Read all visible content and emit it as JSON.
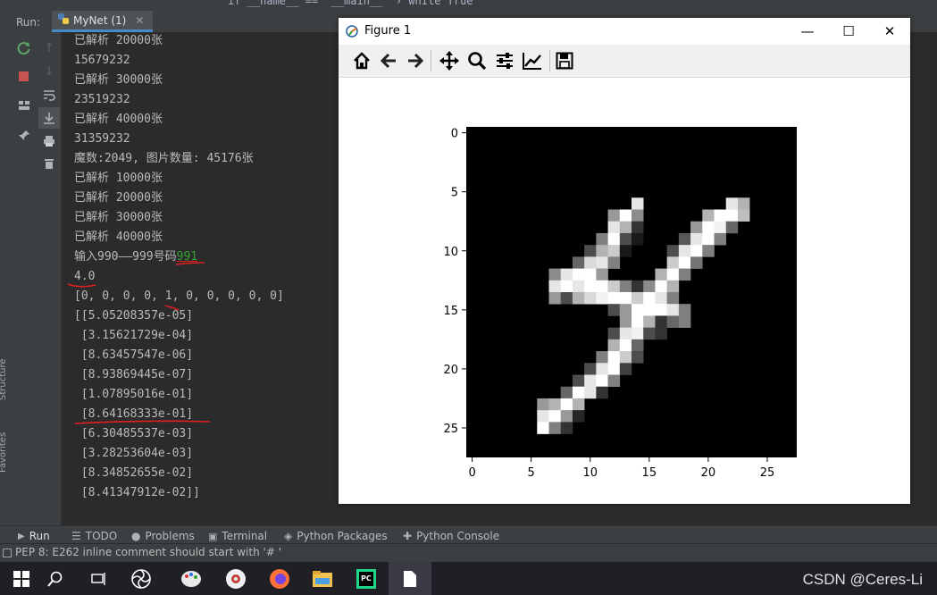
{
  "ide": {
    "breadcrumb": "if __name__ == '__main__'   ›  while True",
    "run_label": "Run:",
    "run_tab": "MyNet (1)",
    "side_labels": [
      "Structure",
      "Favorites"
    ]
  },
  "console": {
    "lines": [
      "已解析 20000张",
      "15679232",
      "已解析 30000张",
      "23519232",
      "已解析 40000张",
      "31359232",
      "魔数:2049, 图片数量: 45176张",
      "已解析 10000张",
      "已解析 20000张",
      "已解析 30000张",
      "已解析 40000张",
      "输入990——999号码",
      "4.0",
      "[0, 0, 0, 0, 1, 0, 0, 0, 0, 0]",
      "[[5.05208357e-05]",
      " [3.15621729e-04]",
      " [8.63457547e-06]",
      " [8.93869445e-07]",
      " [1.07895016e-01]",
      " [8.64168333e-01]",
      " [6.30485537e-03]",
      " [3.28253604e-03]",
      " [8.34852655e-02]",
      " [8.41347912e-02]]"
    ],
    "user_input": "991",
    "user_input_color": "#2fa32f",
    "annotation_color": "#e02020"
  },
  "figure": {
    "window_title": "Figure 1",
    "toolbar_icons": [
      "home-icon",
      "back-icon",
      "forward-icon",
      "pan-icon",
      "zoom-icon",
      "configure-subplots-icon",
      "edit-axis-icon",
      "save-icon"
    ]
  },
  "chart_data": {
    "type": "heatmap",
    "title": "",
    "colormap": "gray",
    "image_size": [
      28,
      28
    ],
    "xticks": [
      0,
      5,
      10,
      15,
      20,
      25
    ],
    "yticks": [
      0,
      5,
      10,
      15,
      20,
      25
    ],
    "pixels": [
      {
        "r": 6,
        "c": 14,
        "v": 0.9
      },
      {
        "r": 6,
        "c": 22,
        "v": 0.9
      },
      {
        "r": 6,
        "c": 23,
        "v": 0.7
      },
      {
        "r": 7,
        "c": 12,
        "v": 0.6
      },
      {
        "r": 7,
        "c": 13,
        "v": 1.0
      },
      {
        "r": 7,
        "c": 14,
        "v": 0.55
      },
      {
        "r": 7,
        "c": 20,
        "v": 0.7
      },
      {
        "r": 7,
        "c": 21,
        "v": 1.0
      },
      {
        "r": 7,
        "c": 22,
        "v": 1.0
      },
      {
        "r": 7,
        "c": 23,
        "v": 0.75
      },
      {
        "r": 8,
        "c": 12,
        "v": 0.9
      },
      {
        "r": 8,
        "c": 13,
        "v": 0.7
      },
      {
        "r": 8,
        "c": 14,
        "v": 0.2
      },
      {
        "r": 8,
        "c": 19,
        "v": 0.6
      },
      {
        "r": 8,
        "c": 20,
        "v": 1.0
      },
      {
        "r": 8,
        "c": 21,
        "v": 0.95
      },
      {
        "r": 8,
        "c": 22,
        "v": 0.4
      },
      {
        "r": 9,
        "c": 11,
        "v": 0.5
      },
      {
        "r": 9,
        "c": 12,
        "v": 1.0
      },
      {
        "r": 9,
        "c": 13,
        "v": 0.3
      },
      {
        "r": 9,
        "c": 14,
        "v": 0.1
      },
      {
        "r": 9,
        "c": 18,
        "v": 0.35
      },
      {
        "r": 9,
        "c": 19,
        "v": 0.9
      },
      {
        "r": 9,
        "c": 20,
        "v": 1.0
      },
      {
        "r": 9,
        "c": 21,
        "v": 0.5
      },
      {
        "r": 10,
        "c": 10,
        "v": 0.3
      },
      {
        "r": 10,
        "c": 11,
        "v": 0.7
      },
      {
        "r": 10,
        "c": 12,
        "v": 0.8
      },
      {
        "r": 10,
        "c": 13,
        "v": 0.1
      },
      {
        "r": 10,
        "c": 17,
        "v": 0.3
      },
      {
        "r": 10,
        "c": 18,
        "v": 0.9
      },
      {
        "r": 10,
        "c": 19,
        "v": 1.0
      },
      {
        "r": 10,
        "c": 20,
        "v": 0.5
      },
      {
        "r": 11,
        "c": 9,
        "v": 0.4
      },
      {
        "r": 11,
        "c": 10,
        "v": 0.85
      },
      {
        "r": 11,
        "c": 11,
        "v": 0.9
      },
      {
        "r": 11,
        "c": 12,
        "v": 0.5
      },
      {
        "r": 11,
        "c": 17,
        "v": 0.8
      },
      {
        "r": 11,
        "c": 18,
        "v": 1.0
      },
      {
        "r": 11,
        "c": 19,
        "v": 0.45
      },
      {
        "r": 12,
        "c": 7,
        "v": 0.55
      },
      {
        "r": 12,
        "c": 8,
        "v": 0.9
      },
      {
        "r": 12,
        "c": 9,
        "v": 1.0
      },
      {
        "r": 12,
        "c": 10,
        "v": 1.0
      },
      {
        "r": 12,
        "c": 11,
        "v": 0.6
      },
      {
        "r": 12,
        "c": 16,
        "v": 0.7
      },
      {
        "r": 12,
        "c": 17,
        "v": 1.0
      },
      {
        "r": 12,
        "c": 18,
        "v": 0.5
      },
      {
        "r": 13,
        "c": 7,
        "v": 0.9
      },
      {
        "r": 13,
        "c": 8,
        "v": 1.0
      },
      {
        "r": 13,
        "c": 9,
        "v": 0.9
      },
      {
        "r": 13,
        "c": 10,
        "v": 1.0
      },
      {
        "r": 13,
        "c": 11,
        "v": 1.0
      },
      {
        "r": 13,
        "c": 12,
        "v": 0.8
      },
      {
        "r": 13,
        "c": 13,
        "v": 0.5
      },
      {
        "r": 13,
        "c": 14,
        "v": 0.2
      },
      {
        "r": 13,
        "c": 15,
        "v": 0.55
      },
      {
        "r": 13,
        "c": 16,
        "v": 1.0
      },
      {
        "r": 13,
        "c": 17,
        "v": 0.7
      },
      {
        "r": 14,
        "c": 7,
        "v": 0.6
      },
      {
        "r": 14,
        "c": 8,
        "v": 0.3
      },
      {
        "r": 14,
        "c": 9,
        "v": 0.7
      },
      {
        "r": 14,
        "c": 10,
        "v": 0.85
      },
      {
        "r": 14,
        "c": 11,
        "v": 0.95
      },
      {
        "r": 14,
        "c": 12,
        "v": 1.0
      },
      {
        "r": 14,
        "c": 13,
        "v": 1.0
      },
      {
        "r": 14,
        "c": 14,
        "v": 0.8
      },
      {
        "r": 14,
        "c": 15,
        "v": 1.0
      },
      {
        "r": 14,
        "c": 16,
        "v": 0.9
      },
      {
        "r": 14,
        "c": 17,
        "v": 0.5
      },
      {
        "r": 15,
        "c": 12,
        "v": 0.3
      },
      {
        "r": 15,
        "c": 13,
        "v": 0.6
      },
      {
        "r": 15,
        "c": 14,
        "v": 1.0
      },
      {
        "r": 15,
        "c": 15,
        "v": 1.0
      },
      {
        "r": 15,
        "c": 16,
        "v": 1.0
      },
      {
        "r": 15,
        "c": 17,
        "v": 0.9
      },
      {
        "r": 15,
        "c": 18,
        "v": 0.5
      },
      {
        "r": 16,
        "c": 13,
        "v": 0.6
      },
      {
        "r": 16,
        "c": 14,
        "v": 1.0
      },
      {
        "r": 16,
        "c": 15,
        "v": 0.7
      },
      {
        "r": 16,
        "c": 16,
        "v": 0.2
      },
      {
        "r": 16,
        "c": 17,
        "v": 0.4
      },
      {
        "r": 16,
        "c": 18,
        "v": 0.5
      },
      {
        "r": 17,
        "c": 12,
        "v": 0.3
      },
      {
        "r": 17,
        "c": 13,
        "v": 0.9
      },
      {
        "r": 17,
        "c": 14,
        "v": 0.95
      },
      {
        "r": 17,
        "c": 15,
        "v": 0.3
      },
      {
        "r": 17,
        "c": 16,
        "v": 0.2
      },
      {
        "r": 18,
        "c": 12,
        "v": 0.7
      },
      {
        "r": 18,
        "c": 13,
        "v": 1.0
      },
      {
        "r": 18,
        "c": 14,
        "v": 0.4
      },
      {
        "r": 19,
        "c": 11,
        "v": 0.5
      },
      {
        "r": 19,
        "c": 12,
        "v": 1.0
      },
      {
        "r": 19,
        "c": 13,
        "v": 0.8
      },
      {
        "r": 19,
        "c": 14,
        "v": 0.3
      },
      {
        "r": 20,
        "c": 10,
        "v": 0.3
      },
      {
        "r": 20,
        "c": 11,
        "v": 0.9
      },
      {
        "r": 20,
        "c": 12,
        "v": 1.0
      },
      {
        "r": 20,
        "c": 13,
        "v": 0.25
      },
      {
        "r": 21,
        "c": 9,
        "v": 0.3
      },
      {
        "r": 21,
        "c": 10,
        "v": 0.9
      },
      {
        "r": 21,
        "c": 11,
        "v": 1.0
      },
      {
        "r": 21,
        "c": 12,
        "v": 0.5
      },
      {
        "r": 22,
        "c": 8,
        "v": 0.4
      },
      {
        "r": 22,
        "c": 9,
        "v": 1.0
      },
      {
        "r": 22,
        "c": 10,
        "v": 0.9
      },
      {
        "r": 22,
        "c": 11,
        "v": 0.2
      },
      {
        "r": 23,
        "c": 6,
        "v": 0.6
      },
      {
        "r": 23,
        "c": 7,
        "v": 0.7
      },
      {
        "r": 23,
        "c": 8,
        "v": 1.0
      },
      {
        "r": 23,
        "c": 9,
        "v": 0.7
      },
      {
        "r": 24,
        "c": 6,
        "v": 0.9
      },
      {
        "r": 24,
        "c": 7,
        "v": 1.0
      },
      {
        "r": 24,
        "c": 8,
        "v": 0.6
      },
      {
        "r": 24,
        "c": 9,
        "v": 0.15
      },
      {
        "r": 25,
        "c": 6,
        "v": 1.0
      },
      {
        "r": 25,
        "c": 7,
        "v": 0.5
      },
      {
        "r": 25,
        "c": 8,
        "v": 0.2
      }
    ]
  },
  "bottom_tabs": [
    "Run",
    "TODO",
    "Problems",
    "Terminal",
    "Python Packages",
    "Python Console"
  ],
  "status": "PEP 8: E262 inline comment should start with '# '",
  "taskbar": {
    "icons": [
      "windows-start-icon",
      "search-icon",
      "task-view-icon",
      "pinwheel-app-icon",
      "paint-app-icon",
      "music-app-icon",
      "firefox-icon",
      "file-explorer-icon",
      "pycharm-icon",
      "document-icon"
    ],
    "watermark": "CSDN @Ceres-Li"
  }
}
